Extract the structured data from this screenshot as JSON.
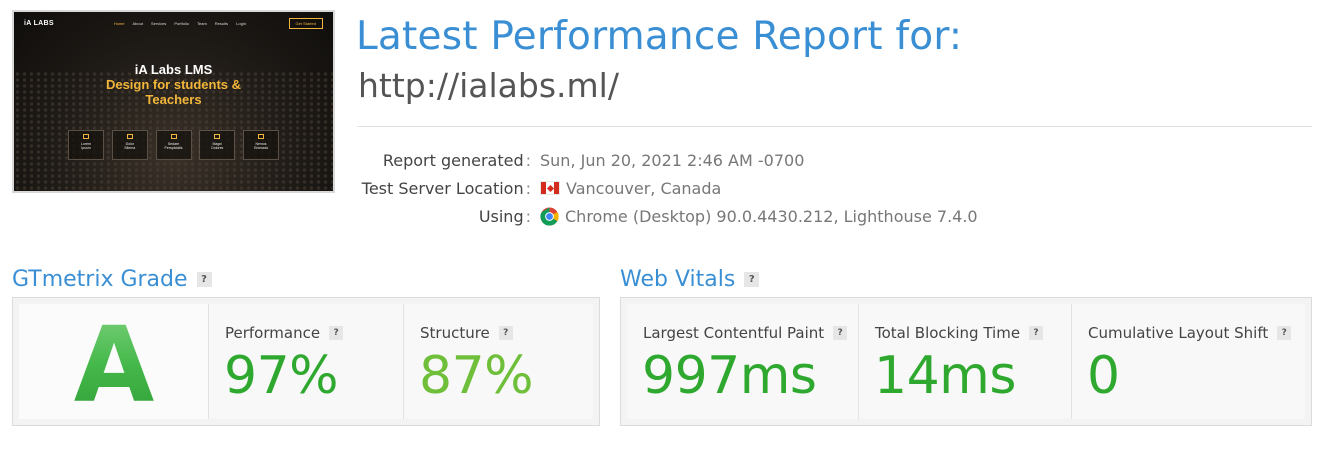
{
  "thumbnail": {
    "logo": "iA LABS",
    "nav_links": [
      "Home",
      "About",
      "Services",
      "Portfolio",
      "Team",
      "Results",
      "Login"
    ],
    "cta": "Get Started",
    "headline_line1": "iA Labs LMS",
    "headline_line2": "Design for students &",
    "headline_line3": "Teachers",
    "features": [
      {
        "line1": "Lorem",
        "line2": "Ipsum"
      },
      {
        "line1": "Dolor",
        "line2": "Sitema"
      },
      {
        "line1": "Sedare",
        "line2": "Perspiciatis"
      },
      {
        "line1": "Magni",
        "line2": "Dolores"
      },
      {
        "line1": "Nemos",
        "line2": "Enimada"
      }
    ]
  },
  "report": {
    "title": "Latest Performance Report for:",
    "url": "http://ialabs.ml/",
    "rows": [
      {
        "label": "Report generated",
        "value": "Sun, Jun 20, 2021 2:46 AM -0700",
        "icon": ""
      },
      {
        "label": "Test Server Location",
        "value": "Vancouver, Canada",
        "icon": "canada-flag-icon"
      },
      {
        "label": "Using",
        "value": "Chrome (Desktop) 90.0.4430.212, Lighthouse 7.4.0",
        "icon": "chrome-icon"
      }
    ],
    "colon": ":"
  },
  "gtmetrix": {
    "heading": "GTmetrix Grade",
    "help": "?",
    "grade": "A",
    "performance_label": "Performance",
    "performance_value": "97%",
    "structure_label": "Structure",
    "structure_value": "87%"
  },
  "web_vitals": {
    "heading": "Web Vitals",
    "help": "?",
    "lcp_label": "Largest Contentful Paint",
    "lcp_value": "997ms",
    "tbt_label": "Total Blocking Time",
    "tbt_value": "14ms",
    "cls_label": "Cumulative Layout Shift",
    "cls_value": "0"
  },
  "colors": {
    "accent_blue": "#3a8fd4",
    "grade_green": "#3cb043",
    "performance_green": "#2ea82e",
    "structure_green": "#6fbf3a"
  }
}
